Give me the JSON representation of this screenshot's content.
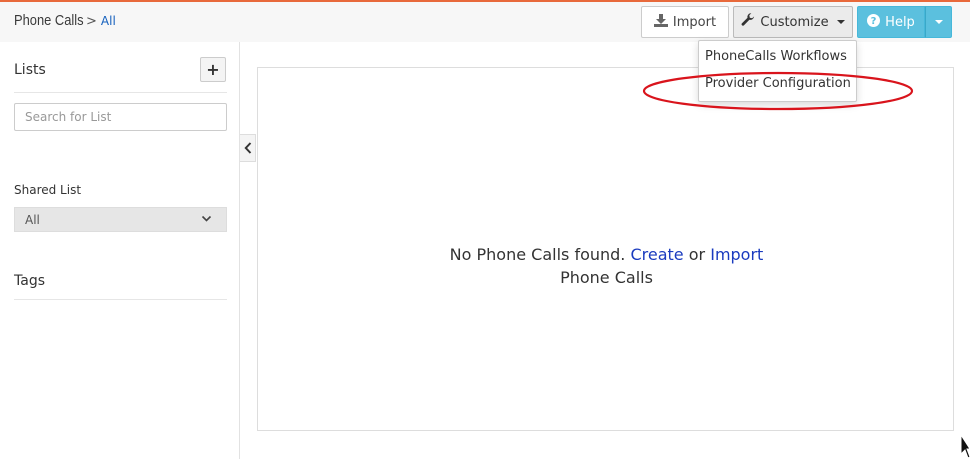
{
  "header": {
    "module_title": "Phone Calls",
    "separator": ">",
    "current_list": "All",
    "import_label": "Import",
    "customize_label": "Customize",
    "help_label": "Help"
  },
  "customize_menu": {
    "items": [
      {
        "label": "PhoneCalls Workflows"
      },
      {
        "label": "Provider Configuration"
      }
    ]
  },
  "sidebar": {
    "lists_title": "Lists",
    "add_label": "+",
    "search_placeholder": "Search for List",
    "shared_list_label": "Shared List",
    "shared_list_value": "All",
    "tags_title": "Tags"
  },
  "main": {
    "empty_prefix": "No Phone Calls found.",
    "create_link": "Create",
    "or_text": "or",
    "import_link": "Import",
    "empty_suffix": "Phone Calls"
  },
  "colors": {
    "accent_orange": "#e8693b",
    "help_button": "#5bc0de",
    "link_blue": "#1a3bbf",
    "highlight_red": "#d9141c"
  }
}
